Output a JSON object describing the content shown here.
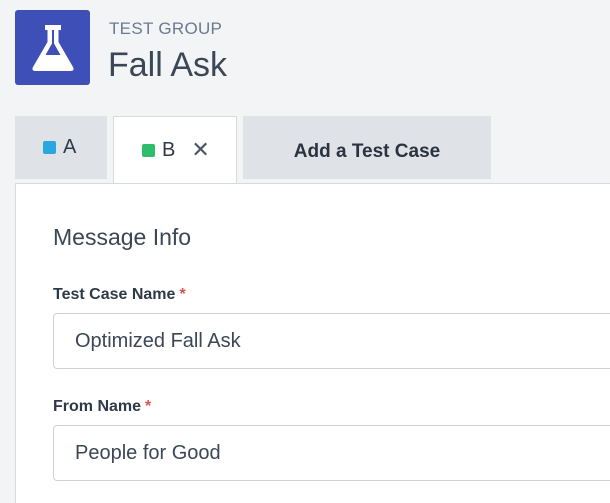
{
  "header": {
    "group_label": "TEST GROUP",
    "title": "Fall Ask",
    "icon": "flask-icon",
    "logo_color": "#3e4fb8"
  },
  "tabs": [
    {
      "label": "A",
      "swatch_color": "#29a8e0",
      "active": false
    },
    {
      "label": "B",
      "swatch_color": "#2ebd6b",
      "active": true,
      "close_icon": "close-icon"
    }
  ],
  "add_tab": {
    "label": "Add a Test Case"
  },
  "form": {
    "section_title": "Message Info",
    "fields": [
      {
        "label": "Test Case Name",
        "required_mark": "*",
        "value": "Optimized Fall Ask"
      },
      {
        "label": "From Name",
        "required_mark": "*",
        "value": "People for Good"
      }
    ]
  }
}
